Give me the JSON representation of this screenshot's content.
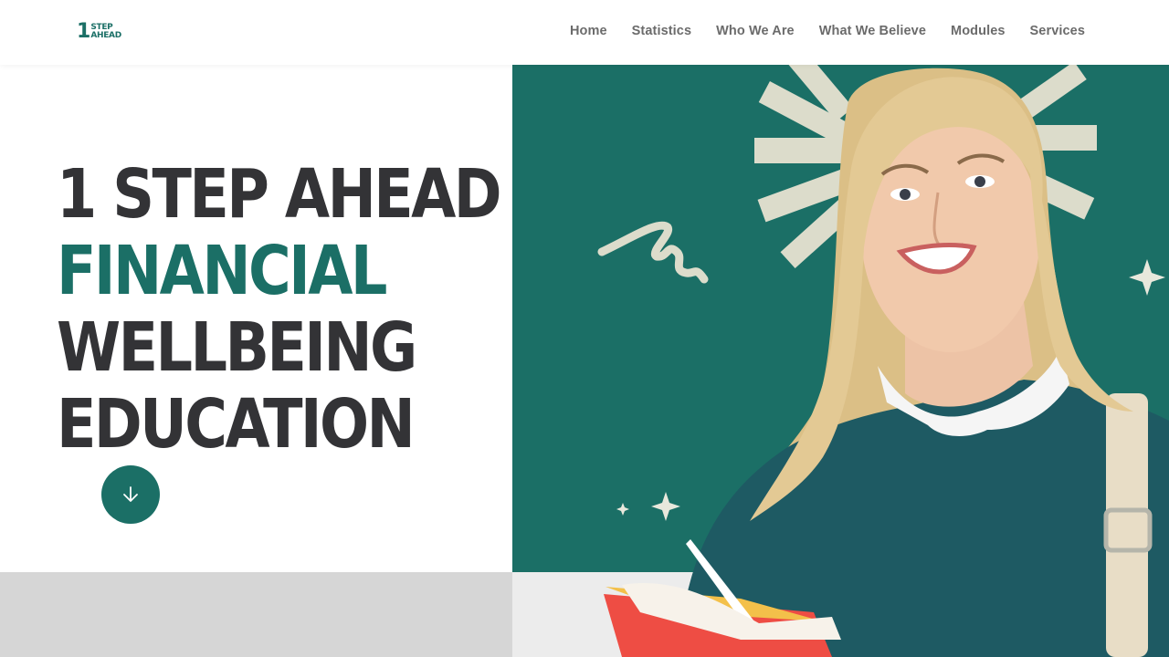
{
  "brand": {
    "logo_number": "1",
    "logo_line1": "STEP",
    "logo_line2": "AHEAD"
  },
  "nav": {
    "items": [
      {
        "label": "Home"
      },
      {
        "label": "Statistics"
      },
      {
        "label": "Who We Are"
      },
      {
        "label": "What We Believe"
      },
      {
        "label": "Modules"
      },
      {
        "label": "Services"
      }
    ]
  },
  "hero": {
    "line1": "1 STEP AHEAD",
    "line2": "FINANCIAL",
    "line3": "WELLBEING",
    "line4": "EDUCATION"
  },
  "colors": {
    "brand_teal": "#1b6f66",
    "heading_dark": "#333336",
    "nav_text": "#6b6b6b"
  },
  "icons": {
    "scroll_button": "arrow-down-icon",
    "photo": "student-photo"
  }
}
